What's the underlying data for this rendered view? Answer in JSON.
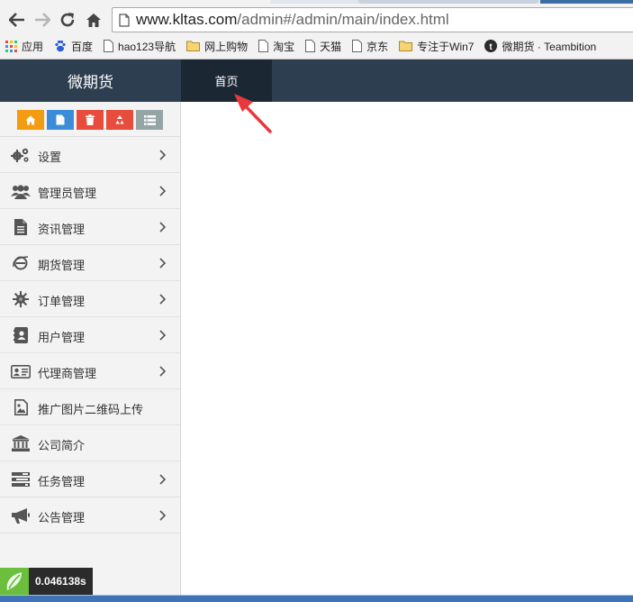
{
  "browser": {
    "url_host": "www.kltas.com",
    "url_rest": "/admin#/admin/main/index.html",
    "bookmarks": [
      {
        "label": "应用",
        "icon": "apps-grid-icon"
      },
      {
        "label": "百度",
        "icon": "baidu-paw-icon"
      },
      {
        "label": "hao123导航",
        "icon": "page-icon"
      },
      {
        "label": "网上购物",
        "icon": "folder-icon"
      },
      {
        "label": "淘宝",
        "icon": "page-icon"
      },
      {
        "label": "天猫",
        "icon": "page-icon"
      },
      {
        "label": "京东",
        "icon": "page-icon"
      },
      {
        "label": "专注于Win7",
        "icon": "folder-icon"
      },
      {
        "label": "微期货 · Teambition",
        "icon": "teambition-icon"
      }
    ]
  },
  "header": {
    "brand": "微期货",
    "active_tab": "首页"
  },
  "shortcuts": [
    {
      "icon": "home-icon",
      "color": "#f39c12"
    },
    {
      "icon": "file-icon",
      "color": "#3c8dd9"
    },
    {
      "icon": "trash-icon",
      "color": "#e74c3c"
    },
    {
      "icon": "recycle-icon",
      "color": "#e74c3c"
    },
    {
      "icon": "list-icon",
      "color": "#95a5a6"
    }
  ],
  "sidebar": {
    "items": [
      {
        "label": "设置",
        "icon": "gears-icon",
        "has_submenu": true
      },
      {
        "label": "管理员管理",
        "icon": "users-icon",
        "has_submenu": true
      },
      {
        "label": "资讯管理",
        "icon": "document-icon",
        "has_submenu": true
      },
      {
        "label": "期货管理",
        "icon": "ie-globe-icon",
        "has_submenu": true
      },
      {
        "label": "订单管理",
        "icon": "sun-badge-icon",
        "has_submenu": true
      },
      {
        "label": "用户管理",
        "icon": "contact-book-icon",
        "has_submenu": true
      },
      {
        "label": "代理商管理",
        "icon": "id-card-icon",
        "has_submenu": true
      },
      {
        "label": "推广图片二维码上传",
        "icon": "image-file-icon",
        "has_submenu": false
      },
      {
        "label": "公司简介",
        "icon": "bank-icon",
        "has_submenu": false
      },
      {
        "label": "任务管理",
        "icon": "tasks-icon",
        "has_submenu": true
      },
      {
        "label": "公告管理",
        "icon": "bullhorn-icon",
        "has_submenu": true
      }
    ]
  },
  "timer": {
    "value": "0.046138s"
  },
  "colors": {
    "header_bg": "#2d3e50",
    "active_tab_bg": "#1c2734",
    "annotation_arrow": "#e8383d"
  }
}
